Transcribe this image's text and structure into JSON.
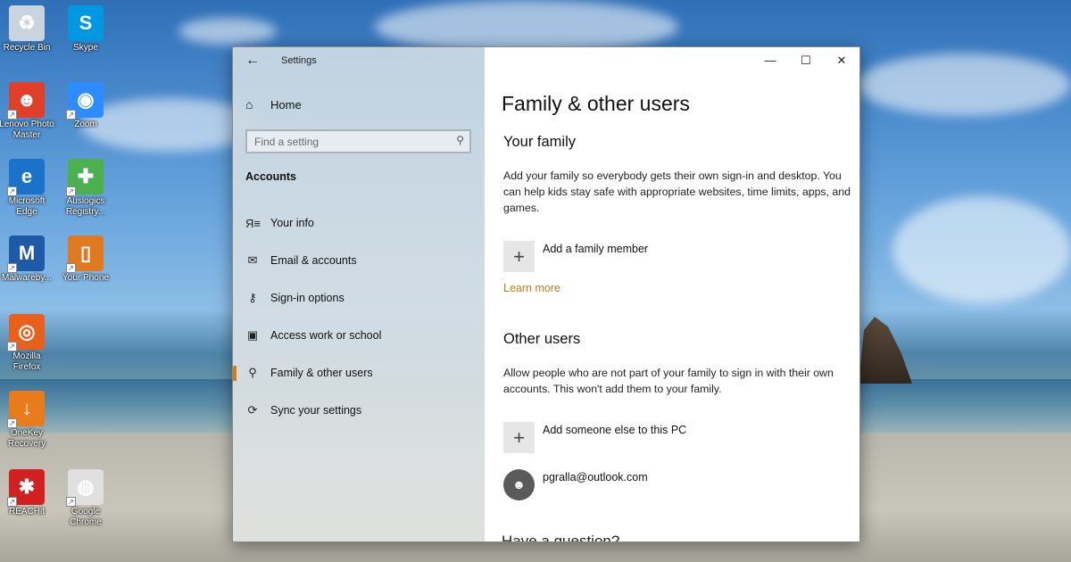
{
  "desktop": {
    "icons": [
      {
        "label": "Recycle Bin",
        "icon": "recycle-bin-icon",
        "color": "#c9d4de"
      },
      {
        "label": "Skype",
        "icon": "skype-icon",
        "color": "#0098e0"
      },
      {
        "label": "Lenovo Photo Master",
        "icon": "photo-master-icon",
        "color": "#e0402a"
      },
      {
        "label": "Zoom",
        "icon": "zoom-icon",
        "color": "#2d8cff"
      },
      {
        "label": "Microsoft Edge",
        "icon": "edge-icon",
        "color": "#1a73c8"
      },
      {
        "label": "Auslogics Registry...",
        "icon": "registry-icon",
        "color": "#4caf50"
      },
      {
        "label": "Malwareby...",
        "icon": "malwarebytes-icon",
        "color": "#1f5aa8"
      },
      {
        "label": "Your Phone",
        "icon": "your-phone-icon",
        "color": "#e07a20"
      },
      {
        "label": "Mozilla Firefox",
        "icon": "firefox-icon",
        "color": "#e8601c"
      },
      {
        "label": "OneKey Recovery",
        "icon": "onekey-recovery-icon",
        "color": "#e87b1c"
      },
      {
        "label": "REACHit",
        "icon": "reachit-icon",
        "color": "#d02020"
      },
      {
        "label": "Google Chrome",
        "icon": "chrome-icon",
        "color": "#e0e0e0"
      }
    ]
  },
  "window": {
    "title": "Settings",
    "back_glyph": "←",
    "controls": {
      "minimize": "—",
      "maximize": "☐",
      "close": "✕"
    }
  },
  "sidebar": {
    "home": "Home",
    "search_placeholder": "Find a setting",
    "section": "Accounts",
    "items": [
      {
        "label": "Your info",
        "icon": "person-card-icon",
        "glyph": "Я≡",
        "active": false
      },
      {
        "label": "Email & accounts",
        "icon": "mail-icon",
        "glyph": "✉",
        "active": false
      },
      {
        "label": "Sign-in options",
        "icon": "key-icon",
        "glyph": "⚷",
        "active": false
      },
      {
        "label": "Access work or school",
        "icon": "briefcase-icon",
        "glyph": "▣",
        "active": false
      },
      {
        "label": "Family & other users",
        "icon": "person-add-icon",
        "glyph": "⚲",
        "active": true
      },
      {
        "label": "Sync your settings",
        "icon": "sync-icon",
        "glyph": "⟳",
        "active": false
      }
    ]
  },
  "main": {
    "title": "Family & other users",
    "your_family": {
      "heading": "Your family",
      "description": "Add your family so everybody gets their own sign-in and desktop. You can help kids stay safe with appropriate websites, time limits, apps, and games.",
      "add_label": "Add a family member",
      "learn_more": "Learn more"
    },
    "other_users": {
      "heading": "Other users",
      "description": "Allow people who are not part of your family to sign in with their own accounts. This won't add them to your family.",
      "add_label": "Add someone else to this PC",
      "user": "pgralla@outlook.com"
    },
    "question": "Have a question?"
  },
  "colors": {
    "accent": "#d17e19",
    "link": "#c47b17"
  }
}
